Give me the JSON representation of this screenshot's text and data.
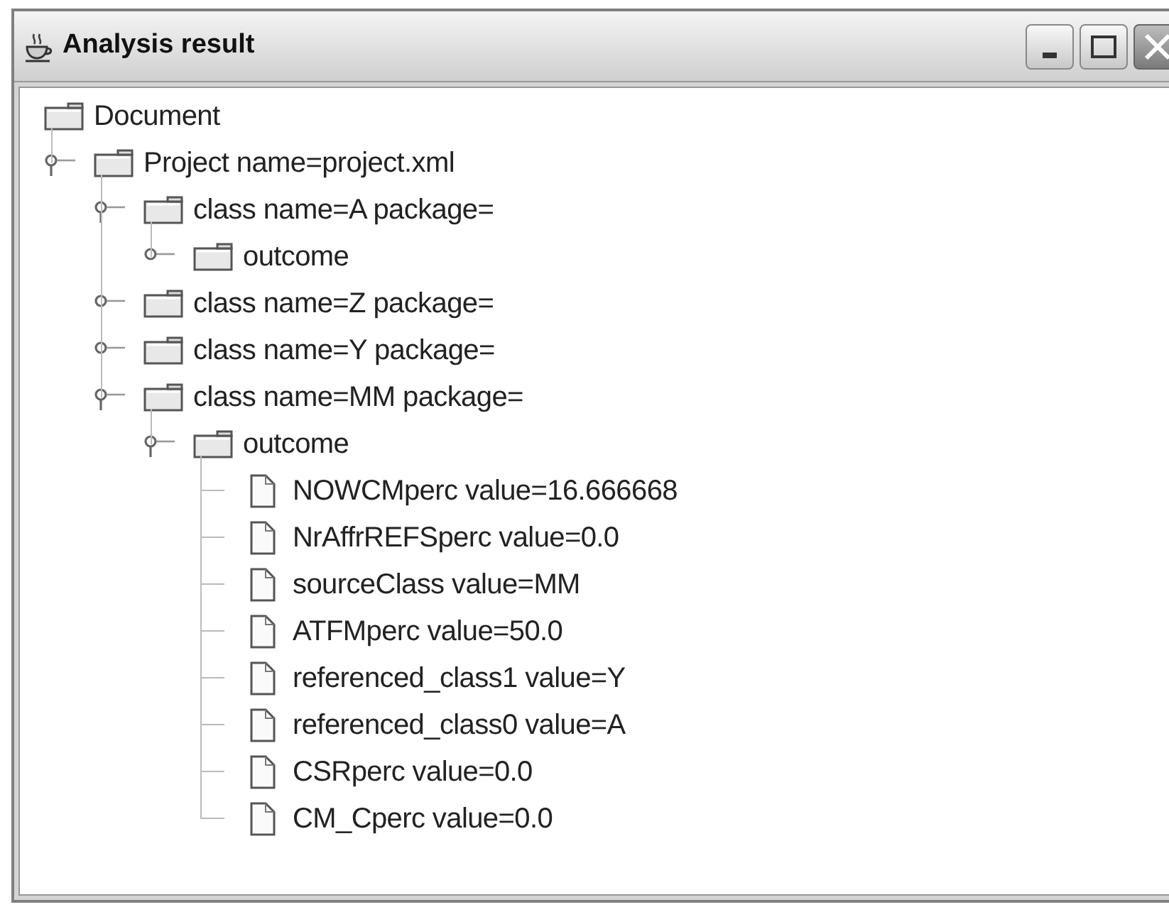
{
  "window": {
    "title": "Analysis result"
  },
  "tree": {
    "label": "Document",
    "kind": "folder",
    "children": [
      {
        "label": "Project name=project.xml",
        "kind": "folder",
        "expanded": true,
        "children": [
          {
            "label": "class name=A package=",
            "kind": "folder",
            "expanded": true,
            "children": [
              {
                "label": "outcome",
                "kind": "folder",
                "expanded": false
              }
            ]
          },
          {
            "label": "class name=Z package=",
            "kind": "folder",
            "expanded": false
          },
          {
            "label": "class name=Y package=",
            "kind": "folder",
            "expanded": false
          },
          {
            "label": "class name=MM package=",
            "kind": "folder",
            "expanded": true,
            "children": [
              {
                "label": "outcome",
                "kind": "folder",
                "expanded": true,
                "children": [
                  {
                    "label": "NOWCMperc value=16.666668",
                    "kind": "file"
                  },
                  {
                    "label": "NrAffrREFSperc value=0.0",
                    "kind": "file"
                  },
                  {
                    "label": "sourceClass value=MM",
                    "kind": "file"
                  },
                  {
                    "label": "ATFMperc value=50.0",
                    "kind": "file"
                  },
                  {
                    "label": "referenced_class1 value=Y",
                    "kind": "file"
                  },
                  {
                    "label": "referenced_class0 value=A",
                    "kind": "file"
                  },
                  {
                    "label": "CSRperc value=0.0",
                    "kind": "file"
                  },
                  {
                    "label": "CM_Cperc value=0.0",
                    "kind": "file"
                  }
                ]
              }
            ]
          }
        ]
      }
    ]
  }
}
